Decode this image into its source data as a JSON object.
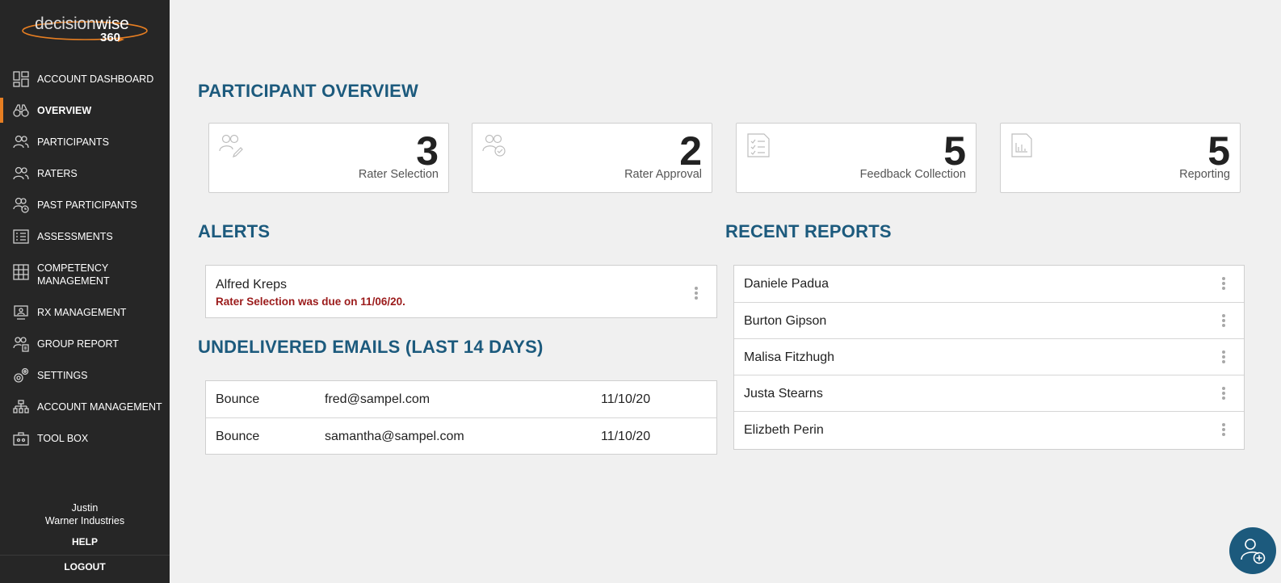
{
  "brand": {
    "logo_word_light": "decision",
    "logo_word_bold": "wise",
    "logo_suffix": "360"
  },
  "sidebar": {
    "items": [
      {
        "label": "ACCOUNT DASHBOARD",
        "icon": "dashboard-icon"
      },
      {
        "label": "OVERVIEW",
        "icon": "binoculars-icon",
        "active": true
      },
      {
        "label": "PARTICIPANTS",
        "icon": "users-icon"
      },
      {
        "label": "RATERS",
        "icon": "users-icon"
      },
      {
        "label": "PAST PARTICIPANTS",
        "icon": "users-clock-icon"
      },
      {
        "label": "ASSESSMENTS",
        "icon": "checklist-icon"
      },
      {
        "label": "COMPETENCY MANAGEMENT",
        "icon": "grid-icon"
      },
      {
        "label": "RX MANAGEMENT",
        "icon": "monitor-user-icon"
      },
      {
        "label": "GROUP REPORT",
        "icon": "users-report-icon"
      },
      {
        "label": "SETTINGS",
        "icon": "gears-icon"
      },
      {
        "label": "ACCOUNT MANAGEMENT",
        "icon": "org-chart-icon"
      },
      {
        "label": "TOOL BOX",
        "icon": "toolbox-icon"
      }
    ],
    "user_name": "Justin",
    "user_company": "Warner Industries",
    "help_label": "HELP",
    "logout_label": "LOGOUT"
  },
  "overview": {
    "title": "PARTICIPANT OVERVIEW",
    "cards": [
      {
        "value": "3",
        "label": "Rater Selection",
        "icon": "users-edit-icon"
      },
      {
        "value": "2",
        "label": "Rater Approval",
        "icon": "users-check-icon"
      },
      {
        "value": "5",
        "label": "Feedback Collection",
        "icon": "checklist-doc-icon"
      },
      {
        "value": "5",
        "label": "Reporting",
        "icon": "report-chart-icon"
      }
    ]
  },
  "alerts": {
    "title": "ALERTS",
    "items": [
      {
        "name": "Alfred Kreps",
        "message": "Rater Selection was due on 11/06/20."
      }
    ]
  },
  "emails": {
    "title": "UNDELIVERED EMAILS (LAST 14 DAYS)",
    "rows": [
      {
        "type": "Bounce",
        "email": "fred@sampel.com",
        "date": "11/10/20"
      },
      {
        "type": "Bounce",
        "email": "samantha@sampel.com",
        "date": "11/10/20"
      }
    ]
  },
  "reports": {
    "title": "RECENT REPORTS",
    "items": [
      "Daniele Padua",
      "Burton Gipson",
      "Malisa Fitzhugh",
      "Justa Stearns",
      "Elizbeth Perin"
    ]
  },
  "fab": {
    "icon": "add-user-icon"
  },
  "colors": {
    "sidebar_bg": "#262626",
    "accent": "#e67e22",
    "heading": "#1c5a7d",
    "alert_text": "#9b1b1b"
  }
}
